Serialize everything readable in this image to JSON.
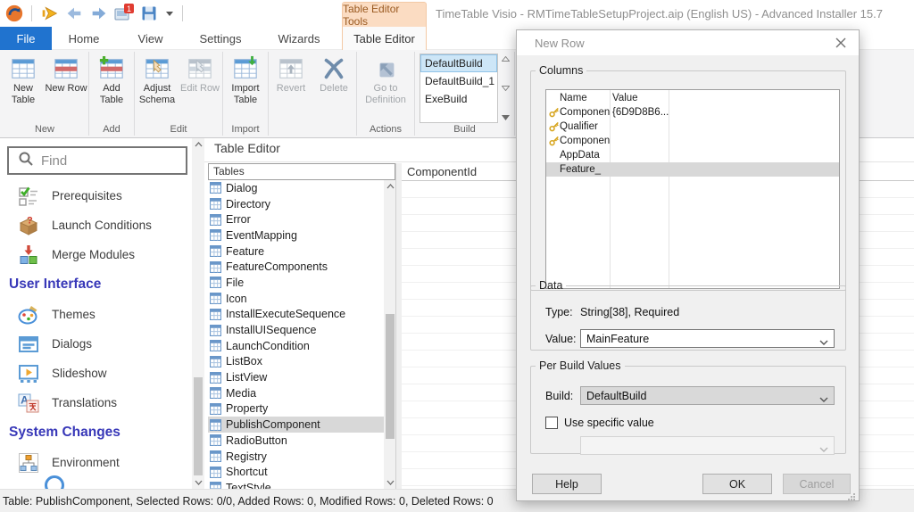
{
  "title_bar": {
    "title": "TimeTable Visio - RMTimeTableSetupProject.aip (English US) - Advanced Installer 15.7",
    "contextual_tab_group": "Table Editor Tools",
    "notification_badge": "1",
    "quick_access_icons": [
      "app-logo-icon",
      "build-arrow-icon",
      "back-arrow-icon",
      "forward-arrow-icon",
      "capture-badge-icon",
      "save-icon",
      "dropdown-caret-icon"
    ]
  },
  "ribbon": {
    "tabs": [
      {
        "label": "File",
        "kind": "file"
      },
      {
        "label": "Home",
        "kind": "home"
      },
      {
        "label": "View",
        "kind": "view"
      },
      {
        "label": "Settings",
        "kind": "settings"
      },
      {
        "label": "Wizards",
        "kind": "wizards"
      },
      {
        "label": "Table Editor",
        "kind": "selected"
      }
    ],
    "groups": [
      {
        "label": "New",
        "buttons": [
          {
            "label": "New Table",
            "icon": "table-new-icon",
            "enabled": true
          },
          {
            "label": "New Row",
            "icon": "table-row-icon",
            "enabled": true
          }
        ]
      },
      {
        "label": "Add",
        "buttons": [
          {
            "label": "Add Table",
            "icon": "table-add-icon",
            "enabled": true
          }
        ]
      },
      {
        "label": "Edit",
        "buttons": [
          {
            "label": "Adjust Schema",
            "icon": "adjust-schema-icon",
            "enabled": true
          },
          {
            "label": "Edit Row",
            "icon": "edit-row-icon",
            "enabled": false
          }
        ]
      },
      {
        "label": "Import",
        "buttons": [
          {
            "label": "Import Table",
            "icon": "table-import-icon",
            "enabled": true
          }
        ]
      },
      {
        "label": "",
        "buttons": [
          {
            "label": "Revert",
            "icon": "revert-icon",
            "enabled": false
          },
          {
            "label": "Delete",
            "icon": "delete-x-icon",
            "enabled": false
          }
        ]
      },
      {
        "label": "Actions",
        "buttons": [
          {
            "label": "Go to Definition",
            "icon": "goto-definition-icon",
            "enabled": false,
            "wide": true
          }
        ]
      }
    ],
    "build_group": {
      "label": "Build",
      "items": [
        "DefaultBuild",
        "DefaultBuild_1",
        "ExeBuild"
      ],
      "selected": "DefaultBuild"
    }
  },
  "sidebar": {
    "search_placeholder": "Find",
    "items": [
      {
        "type": "item",
        "label": "Prerequisites",
        "icon": "prerequisites-icon"
      },
      {
        "type": "item",
        "label": "Launch Conditions",
        "icon": "launch-conditions-icon"
      },
      {
        "type": "item",
        "label": "Merge Modules",
        "icon": "merge-modules-icon"
      },
      {
        "type": "header",
        "label": "User Interface"
      },
      {
        "type": "item",
        "label": "Themes",
        "icon": "themes-icon"
      },
      {
        "type": "item",
        "label": "Dialogs",
        "icon": "dialogs-icon"
      },
      {
        "type": "item",
        "label": "Slideshow",
        "icon": "slideshow-icon"
      },
      {
        "type": "item",
        "label": "Translations",
        "icon": "translations-icon"
      },
      {
        "type": "header",
        "label": "System Changes"
      },
      {
        "type": "item",
        "label": "Environment",
        "icon": "environment-icon"
      }
    ]
  },
  "table_editor": {
    "panel_title": "Table Editor",
    "tables_header": "Tables",
    "selected_table": "PublishComponent",
    "tables": [
      "Dialog",
      "Directory",
      "Error",
      "EventMapping",
      "Feature",
      "FeatureComponents",
      "File",
      "Icon",
      "InstallExecuteSequence",
      "InstallUISequence",
      "LaunchCondition",
      "ListBox",
      "ListView",
      "Media",
      "Property",
      "PublishComponent",
      "RadioButton",
      "Registry",
      "Shortcut",
      "TextStyle"
    ],
    "grid_column_header": "ComponentId"
  },
  "dialog": {
    "title": "New Row",
    "columns_group": {
      "label": "Columns",
      "headers": {
        "name": "Name",
        "value": "Value"
      },
      "rows": [
        {
          "key": true,
          "name": "Componen...",
          "value": "{6D9D8B6...",
          "blurred": false,
          "selected": false
        },
        {
          "key": true,
          "name": "Qualifier",
          "value": "",
          "blurred": true,
          "blur_width": 52,
          "selected": false
        },
        {
          "key": true,
          "name": "Component_",
          "value": "",
          "blurred": true,
          "blur_width": 56,
          "selected": false
        },
        {
          "key": false,
          "name": "AppData",
          "value": "",
          "blurred": true,
          "blur_width": 58,
          "selected": false
        },
        {
          "key": false,
          "name": "Feature_",
          "value": "",
          "blurred": false,
          "selected": true
        }
      ]
    },
    "data_group": {
      "label": "Data",
      "type_label": "Type:",
      "type_value": "String[38], Required",
      "value_label": "Value:",
      "value": "MainFeature"
    },
    "per_build_group": {
      "label": "Per Build Values",
      "build_label": "Build:",
      "build_value": "DefaultBuild",
      "checkbox_label": "Use specific value",
      "checkbox_checked": false
    },
    "buttons": {
      "help": "Help",
      "ok": "OK",
      "cancel": "Cancel"
    }
  },
  "status_bar": {
    "text": "Table: PublishComponent, Selected Rows: 0/0, Added Rows: 0, Modified Rows: 0, Deleted Rows: 0"
  }
}
